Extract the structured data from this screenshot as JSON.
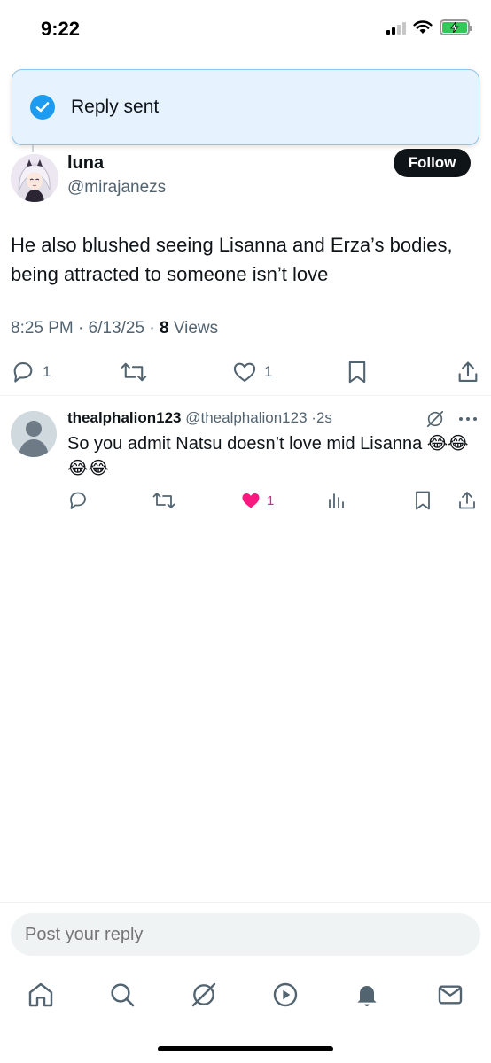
{
  "status_bar": {
    "time": "9:22"
  },
  "toast": {
    "message": "Reply sent"
  },
  "tweet": {
    "author_name": "luna",
    "author_handle": "@mirajanezs",
    "follow_label": "Follow",
    "text": "He also blushed seeing Lisanna and Erza’s bodies, being attracted to someone isn’t love",
    "time": "8:25 PM",
    "date": "6/13/25",
    "views_count": "8",
    "views_label": "Views",
    "reply_count": "1",
    "like_count": "1"
  },
  "reply": {
    "author_name": "thealphalion123",
    "author_handle": "@thealphalion123",
    "age": "2s",
    "text": "So you admit Natsu doesn’t love mid Lisanna 😂😂😂😂",
    "like_count": "1"
  },
  "composer": {
    "placeholder": "Post your reply"
  },
  "tabs": [
    "home-icon",
    "search-icon",
    "grok-icon",
    "video-icon",
    "notifications-icon",
    "messages-icon"
  ],
  "colors": {
    "accent": "#1d9bf0",
    "like": "#f91880",
    "secondary_text": "#536471"
  }
}
